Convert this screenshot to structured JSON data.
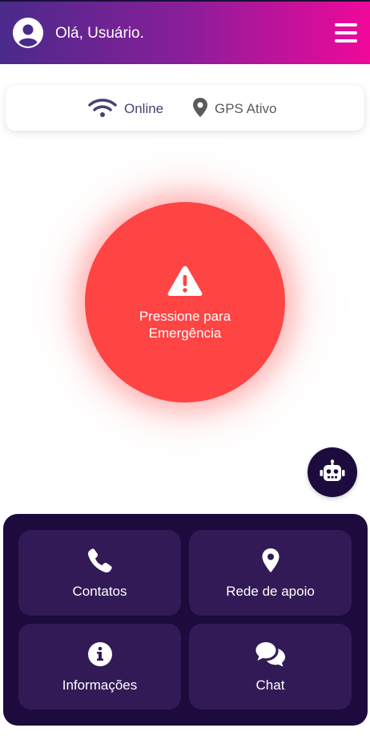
{
  "header": {
    "greeting": "Olá, Usuário.",
    "avatar_icon": "user-circle-icon",
    "menu_icon": "hamburger-menu-icon",
    "gradient": [
      "#4a2a8a",
      "#f0089a"
    ]
  },
  "status": {
    "online": {
      "label": "Online",
      "icon": "wifi-icon"
    },
    "gps": {
      "label": "GPS Ativo",
      "icon": "location-pin-icon"
    }
  },
  "emergency": {
    "line1": "Pressione para",
    "line2": "Emergência",
    "icon": "warning-triangle-icon",
    "color": "#ff4444"
  },
  "bot": {
    "icon": "robot-icon"
  },
  "actions": [
    {
      "label": "Contatos",
      "icon": "phone-icon"
    },
    {
      "label": "Rede de apoio",
      "icon": "location-pin-icon"
    },
    {
      "label": "Informações",
      "icon": "info-icon"
    },
    {
      "label": "Chat",
      "icon": "chat-bubbles-icon"
    }
  ],
  "colors": {
    "panel": "#1e0b3e",
    "tile": "#321a56",
    "accent_text": "#4a3f73"
  }
}
